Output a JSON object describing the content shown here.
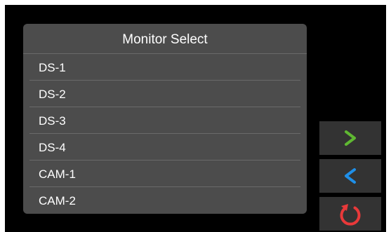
{
  "dialog": {
    "title": "Monitor Select",
    "items": [
      {
        "label": "DS-1"
      },
      {
        "label": "DS-2"
      },
      {
        "label": "DS-3"
      },
      {
        "label": "DS-4"
      },
      {
        "label": "CAM-1"
      },
      {
        "label": "CAM-2"
      }
    ]
  },
  "controls": {
    "next": {
      "icon": "chevron-right-icon",
      "color": "#5fb832"
    },
    "previous": {
      "icon": "chevron-left-icon",
      "color": "#1f8fe8"
    },
    "back": {
      "icon": "undo-circle-icon",
      "color": "#e8393a"
    }
  },
  "theme": {
    "background": "#000000",
    "panel": "#4c4c4c",
    "button": "#333333",
    "text": "#ffffff"
  }
}
